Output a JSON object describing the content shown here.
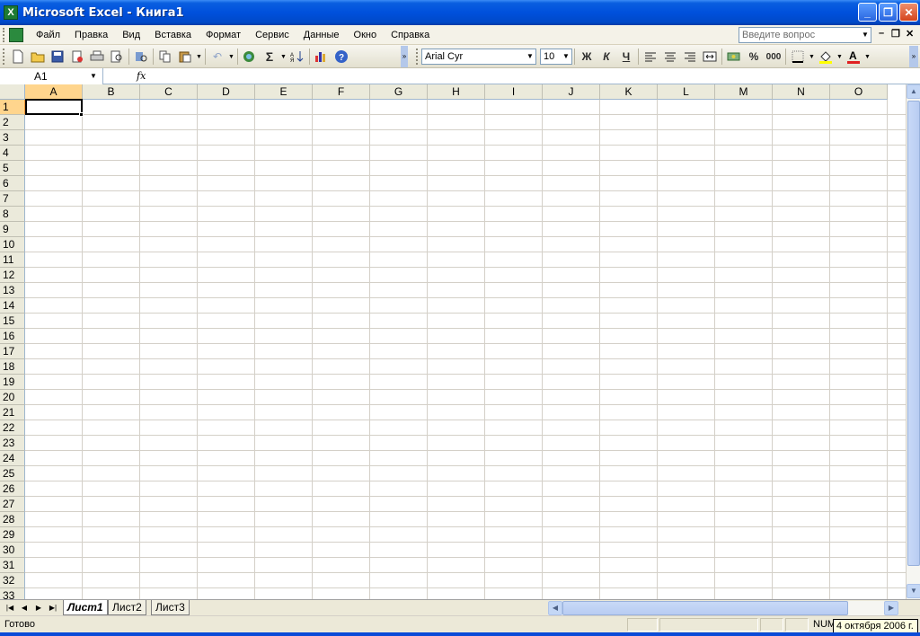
{
  "window": {
    "title": "Microsoft Excel - Книга1",
    "app_icon_label": "X",
    "minimize": "_",
    "maximize": "❐",
    "close": "✕"
  },
  "menubar": {
    "items": [
      "Файл",
      "Правка",
      "Вид",
      "Вставка",
      "Формат",
      "Сервис",
      "Данные",
      "Окно",
      "Справка"
    ],
    "ask_placeholder": "Введите вопрос",
    "doc_minimize": "–",
    "doc_restore": "❐",
    "doc_close": "✕"
  },
  "toolbar": {
    "font_name": "Arial Cyr",
    "font_size": "10",
    "bold": "Ж",
    "italic": "К",
    "underline": "Ч",
    "sum": "Σ",
    "percent": "%",
    "thousands": "000",
    "font_color_label": "A"
  },
  "formula_bar": {
    "name_box": "A1",
    "fx": "fx",
    "value": ""
  },
  "grid": {
    "columns": [
      "A",
      "B",
      "C",
      "D",
      "E",
      "F",
      "G",
      "H",
      "I",
      "J",
      "K",
      "L",
      "M",
      "N",
      "O"
    ],
    "rows": [
      "1",
      "2",
      "3",
      "4",
      "5",
      "6",
      "7",
      "8",
      "9",
      "10",
      "11",
      "12",
      "13",
      "14",
      "15",
      "16",
      "17",
      "18",
      "19",
      "20",
      "21",
      "22",
      "23",
      "24",
      "25",
      "26",
      "27",
      "28",
      "29",
      "30",
      "31",
      "32",
      "33"
    ],
    "active_cell": "A1",
    "active_column": "A",
    "active_row": "1"
  },
  "sheets": {
    "tabs": [
      "Лист1",
      "Лист2",
      "Лист3"
    ],
    "active": "Лист1"
  },
  "status": {
    "text": "Готово",
    "num": "NUM",
    "tooltip": "4 октября 2006 г."
  },
  "colors": {
    "titlebar": "#0050DC",
    "active_header": "#FFD58D",
    "grid_line": "#D4D0C8"
  }
}
